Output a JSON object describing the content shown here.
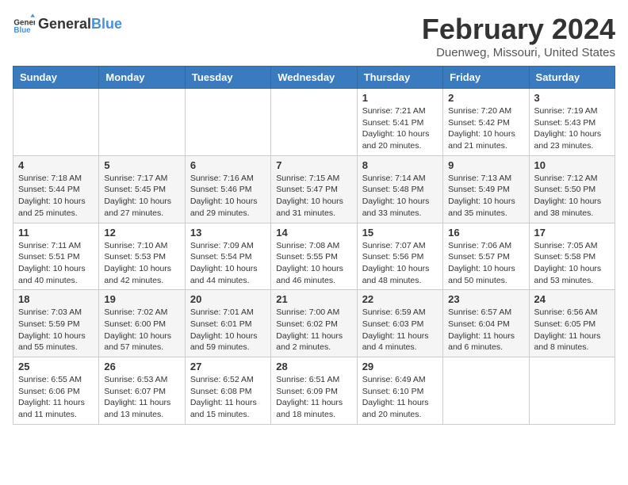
{
  "header": {
    "logo_general": "General",
    "logo_blue": "Blue",
    "month": "February 2024",
    "location": "Duenweg, Missouri, United States"
  },
  "days_of_week": [
    "Sunday",
    "Monday",
    "Tuesday",
    "Wednesday",
    "Thursday",
    "Friday",
    "Saturday"
  ],
  "weeks": [
    [
      {
        "day": "",
        "info": ""
      },
      {
        "day": "",
        "info": ""
      },
      {
        "day": "",
        "info": ""
      },
      {
        "day": "",
        "info": ""
      },
      {
        "day": "1",
        "info": "Sunrise: 7:21 AM\nSunset: 5:41 PM\nDaylight: 10 hours\nand 20 minutes."
      },
      {
        "day": "2",
        "info": "Sunrise: 7:20 AM\nSunset: 5:42 PM\nDaylight: 10 hours\nand 21 minutes."
      },
      {
        "day": "3",
        "info": "Sunrise: 7:19 AM\nSunset: 5:43 PM\nDaylight: 10 hours\nand 23 minutes."
      }
    ],
    [
      {
        "day": "4",
        "info": "Sunrise: 7:18 AM\nSunset: 5:44 PM\nDaylight: 10 hours\nand 25 minutes."
      },
      {
        "day": "5",
        "info": "Sunrise: 7:17 AM\nSunset: 5:45 PM\nDaylight: 10 hours\nand 27 minutes."
      },
      {
        "day": "6",
        "info": "Sunrise: 7:16 AM\nSunset: 5:46 PM\nDaylight: 10 hours\nand 29 minutes."
      },
      {
        "day": "7",
        "info": "Sunrise: 7:15 AM\nSunset: 5:47 PM\nDaylight: 10 hours\nand 31 minutes."
      },
      {
        "day": "8",
        "info": "Sunrise: 7:14 AM\nSunset: 5:48 PM\nDaylight: 10 hours\nand 33 minutes."
      },
      {
        "day": "9",
        "info": "Sunrise: 7:13 AM\nSunset: 5:49 PM\nDaylight: 10 hours\nand 35 minutes."
      },
      {
        "day": "10",
        "info": "Sunrise: 7:12 AM\nSunset: 5:50 PM\nDaylight: 10 hours\nand 38 minutes."
      }
    ],
    [
      {
        "day": "11",
        "info": "Sunrise: 7:11 AM\nSunset: 5:51 PM\nDaylight: 10 hours\nand 40 minutes."
      },
      {
        "day": "12",
        "info": "Sunrise: 7:10 AM\nSunset: 5:53 PM\nDaylight: 10 hours\nand 42 minutes."
      },
      {
        "day": "13",
        "info": "Sunrise: 7:09 AM\nSunset: 5:54 PM\nDaylight: 10 hours\nand 44 minutes."
      },
      {
        "day": "14",
        "info": "Sunrise: 7:08 AM\nSunset: 5:55 PM\nDaylight: 10 hours\nand 46 minutes."
      },
      {
        "day": "15",
        "info": "Sunrise: 7:07 AM\nSunset: 5:56 PM\nDaylight: 10 hours\nand 48 minutes."
      },
      {
        "day": "16",
        "info": "Sunrise: 7:06 AM\nSunset: 5:57 PM\nDaylight: 10 hours\nand 50 minutes."
      },
      {
        "day": "17",
        "info": "Sunrise: 7:05 AM\nSunset: 5:58 PM\nDaylight: 10 hours\nand 53 minutes."
      }
    ],
    [
      {
        "day": "18",
        "info": "Sunrise: 7:03 AM\nSunset: 5:59 PM\nDaylight: 10 hours\nand 55 minutes."
      },
      {
        "day": "19",
        "info": "Sunrise: 7:02 AM\nSunset: 6:00 PM\nDaylight: 10 hours\nand 57 minutes."
      },
      {
        "day": "20",
        "info": "Sunrise: 7:01 AM\nSunset: 6:01 PM\nDaylight: 10 hours\nand 59 minutes."
      },
      {
        "day": "21",
        "info": "Sunrise: 7:00 AM\nSunset: 6:02 PM\nDaylight: 11 hours\nand 2 minutes."
      },
      {
        "day": "22",
        "info": "Sunrise: 6:59 AM\nSunset: 6:03 PM\nDaylight: 11 hours\nand 4 minutes."
      },
      {
        "day": "23",
        "info": "Sunrise: 6:57 AM\nSunset: 6:04 PM\nDaylight: 11 hours\nand 6 minutes."
      },
      {
        "day": "24",
        "info": "Sunrise: 6:56 AM\nSunset: 6:05 PM\nDaylight: 11 hours\nand 8 minutes."
      }
    ],
    [
      {
        "day": "25",
        "info": "Sunrise: 6:55 AM\nSunset: 6:06 PM\nDaylight: 11 hours\nand 11 minutes."
      },
      {
        "day": "26",
        "info": "Sunrise: 6:53 AM\nSunset: 6:07 PM\nDaylight: 11 hours\nand 13 minutes."
      },
      {
        "day": "27",
        "info": "Sunrise: 6:52 AM\nSunset: 6:08 PM\nDaylight: 11 hours\nand 15 minutes."
      },
      {
        "day": "28",
        "info": "Sunrise: 6:51 AM\nSunset: 6:09 PM\nDaylight: 11 hours\nand 18 minutes."
      },
      {
        "day": "29",
        "info": "Sunrise: 6:49 AM\nSunset: 6:10 PM\nDaylight: 11 hours\nand 20 minutes."
      },
      {
        "day": "",
        "info": ""
      },
      {
        "day": "",
        "info": ""
      }
    ]
  ]
}
